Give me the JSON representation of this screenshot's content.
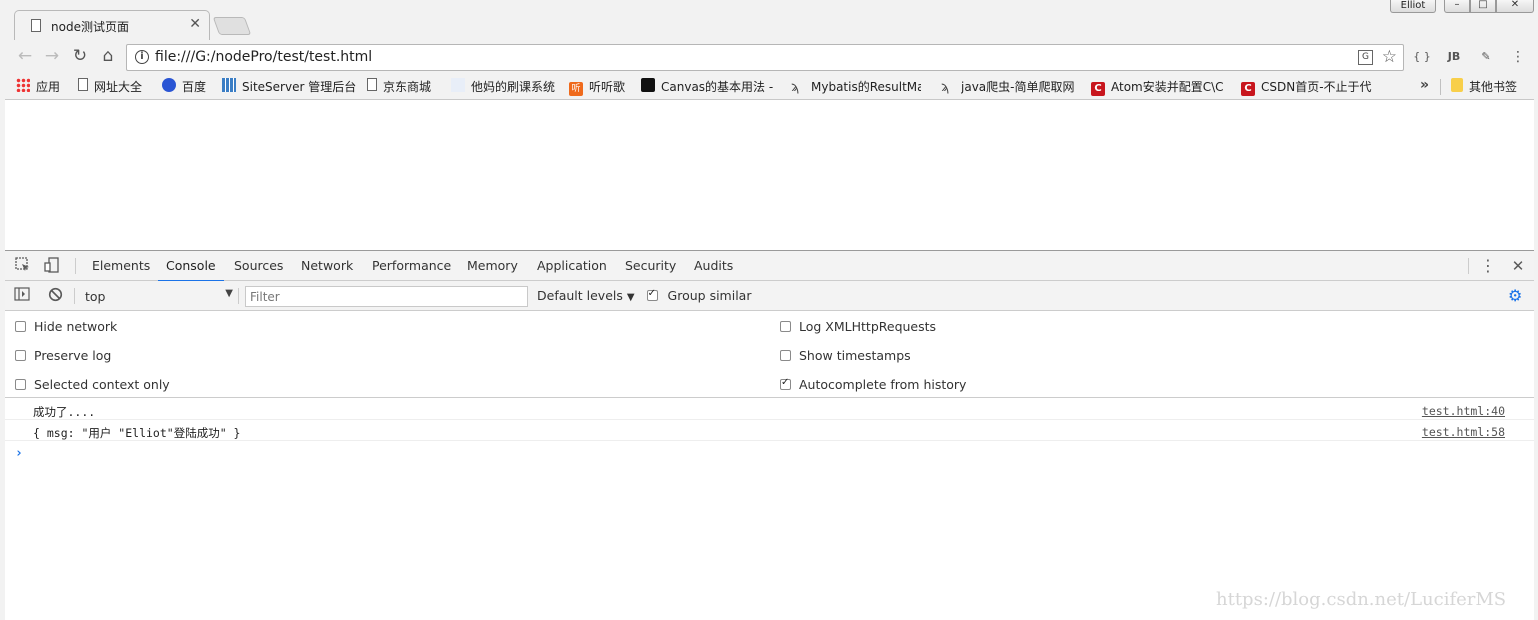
{
  "window": {
    "tab_title": "node测试页面",
    "tab_close": "✕",
    "profile_name": "Elliot",
    "controls": {
      "minimize": "–",
      "maximize": "□",
      "close": "✕"
    }
  },
  "toolbar": {
    "back": "←",
    "forward": "→",
    "reload": "↻",
    "home": "⌂",
    "url": "file:///G:/nodePro/test/test.html",
    "info_glyph": "i",
    "translate_glyph": "G",
    "star_glyph": "☆",
    "extensions": [
      "{ }",
      "JB",
      "✎",
      "⋮"
    ]
  },
  "bookmarks": {
    "items": [
      {
        "label": "应用",
        "icon": "apps-icon"
      },
      {
        "label": "网址大全",
        "icon": "page-icon"
      },
      {
        "label": "百度",
        "icon": "baidu-icon"
      },
      {
        "label": "SiteServer 管理后台",
        "icon": "siteserver-icon"
      },
      {
        "label": "京东商城",
        "icon": "page-icon"
      },
      {
        "label": "他妈的刷课系统",
        "icon": "blank-icon"
      },
      {
        "label": "听听歌",
        "icon": "tingting-icon"
      },
      {
        "label": "Canvas的基本用法 -",
        "icon": "canvas-icon"
      },
      {
        "label": "Mybatis的ResultMa",
        "icon": "bird-icon"
      },
      {
        "label": "java爬虫-简单爬取网",
        "icon": "bird-icon"
      },
      {
        "label": "Atom安装并配置C\\C",
        "icon": "csdn-icon"
      },
      {
        "label": "CSDN首页-不止于代",
        "icon": "csdn-icon"
      }
    ],
    "overflow": "»",
    "other": "其他书签"
  },
  "devtools": {
    "tabs": [
      "Elements",
      "Console",
      "Sources",
      "Network",
      "Performance",
      "Memory",
      "Application",
      "Security",
      "Audits"
    ],
    "active_tab": "Console",
    "context": "top",
    "filter_placeholder": "Filter",
    "levels": "Default levels",
    "levels_arrow": "▼",
    "group_similar": "Group similar",
    "group_similar_checked": true,
    "settings": {
      "left": [
        {
          "label": "Hide network",
          "checked": false
        },
        {
          "label": "Preserve log",
          "checked": false
        },
        {
          "label": "Selected context only",
          "checked": false
        }
      ],
      "right": [
        {
          "label": "Log XMLHttpRequests",
          "checked": false
        },
        {
          "label": "Show timestamps",
          "checked": false
        },
        {
          "label": "Autocomplete from history",
          "checked": true
        }
      ]
    },
    "console": {
      "messages": [
        {
          "text": "成功了....",
          "source": "test.html:40"
        },
        {
          "text": "{ msg: \"用户 \"Elliot\"登陆成功\" }",
          "source": "test.html:58"
        }
      ],
      "prompt": "›"
    }
  },
  "watermark": "https://blog.csdn.net/LuciferMS",
  "colors": {
    "accent": "#1a73e8",
    "chrome_bg": "#f2f2f2",
    "devtools_bg": "#f3f3f3"
  }
}
